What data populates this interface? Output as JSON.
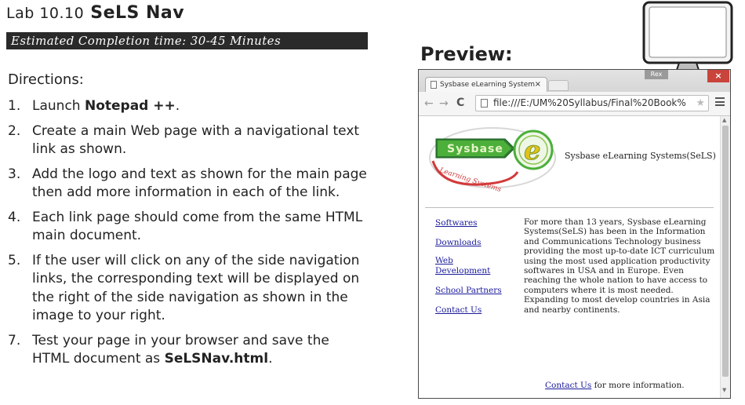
{
  "lab": {
    "number": "Lab 10.10",
    "name": "SeLS Nav",
    "estimated_time": "Estimated Completion time: 30-45 Minutes"
  },
  "directions": {
    "label": "Directions:",
    "steps": [
      {
        "num": "1.",
        "before": "Launch ",
        "bold": "Notepad ++",
        "after": "."
      },
      {
        "num": "2.",
        "before": "Create a main Web page with a navigational text link as shown.",
        "bold": "",
        "after": ""
      },
      {
        "num": "3.",
        "before": "Add the logo and text as shown for the main page then add more information in each of the link.",
        "bold": "",
        "after": ""
      },
      {
        "num": "4.",
        "before": "Each link page should come from the same HTML main document.",
        "bold": "",
        "after": ""
      },
      {
        "num": "5.",
        "before": "If the user will click on any of the side navigation links, the corresponding text will be displayed on the right of the side navigation as shown in the image to your right.",
        "bold": "",
        "after": ""
      },
      {
        "num": "7.",
        "before": "Test your page in your browser and save  the HTML document as ",
        "bold": "SeLSNav.html",
        "after": "."
      }
    ]
  },
  "preview": {
    "label": "Preview:"
  },
  "browser": {
    "tab_title": "Sysbase eLearning System",
    "tab_close": "×",
    "user_badge": "Rex",
    "window_close": "×",
    "back": "←",
    "forward": "→",
    "reload": "C",
    "url": "file:///E:/UM%20Syllabus/Final%20Book%",
    "star": "★"
  },
  "page": {
    "logo_word": "Sysbase",
    "logo_tagline": "Learning Systems",
    "logo_letter": "e",
    "site_title": "Sysbase eLearning Systems(SeLS)",
    "nav": [
      {
        "label": "Softwares"
      },
      {
        "label": "Downloads"
      },
      {
        "label": "Web Development"
      },
      {
        "label": "School Partners"
      },
      {
        "label": "Contact Us"
      }
    ],
    "body": "For more than 13 years, Sysbase eLearning Systems(SeLS) has been in the Information and Communications Technology business providing the most up-to-date ICT curriculum using the most used application productivity softwares in USA and in Europe. Even reaching the whole nation to have access to computers where it is most needed. Expanding to most develop countries in Asia and nearby continents.",
    "footer_link": "Contact Us",
    "footer_rest": " for more information."
  },
  "colors": {
    "link": "#1a1a9c",
    "time_bar": "#2a2a2a",
    "logo_green": "#4caf3a",
    "logo_red": "#d23a3a",
    "close_red": "#c9443b"
  }
}
